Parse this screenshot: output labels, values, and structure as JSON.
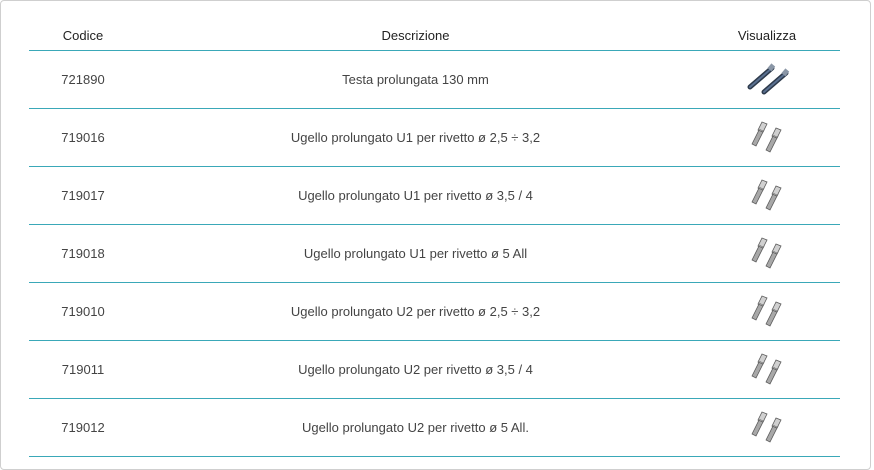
{
  "table": {
    "headers": {
      "code": "Codice",
      "description": "Descrizione",
      "view": "Visualizza"
    },
    "rows": [
      {
        "code": "721890",
        "description": "Testa prolungata 130 mm",
        "icon": "extension-rod-icon"
      },
      {
        "code": "719016",
        "description": "Ugello prolungato U1 per rivetto ø 2,5 ÷ 3,2",
        "icon": "nozzle-pair-icon"
      },
      {
        "code": "719017",
        "description": "Ugello prolungato U1 per rivetto ø 3,5 / 4",
        "icon": "nozzle-pair-icon"
      },
      {
        "code": "719018",
        "description": "Ugello prolungato U1 per rivetto ø 5 All",
        "icon": "nozzle-pair-icon"
      },
      {
        "code": "719010",
        "description": "Ugello prolungato U2 per rivetto ø 2,5 ÷ 3,2",
        "icon": "nozzle-pair-icon"
      },
      {
        "code": "719011",
        "description": "Ugello prolungato U2 per rivetto ø 3,5 / 4",
        "icon": "nozzle-pair-icon"
      },
      {
        "code": "719012",
        "description": "Ugello prolungato U2 per rivetto ø 5 All.",
        "icon": "nozzle-pair-icon"
      }
    ]
  },
  "colors": {
    "divider": "#3aa8b8",
    "rod": "#3d4e63",
    "metal": "#9a9a9a"
  }
}
